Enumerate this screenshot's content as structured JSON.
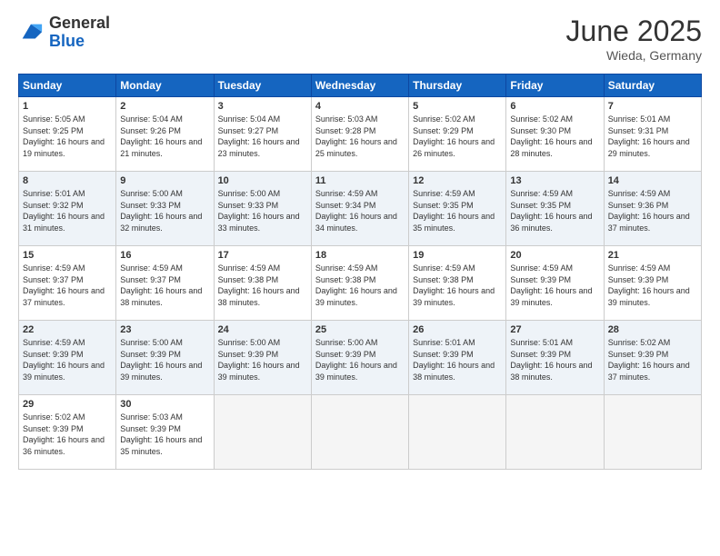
{
  "logo": {
    "general": "General",
    "blue": "Blue"
  },
  "title": {
    "month": "June 2025",
    "location": "Wieda, Germany"
  },
  "days_header": [
    "Sunday",
    "Monday",
    "Tuesday",
    "Wednesday",
    "Thursday",
    "Friday",
    "Saturday"
  ],
  "weeks": [
    [
      {
        "day": "1",
        "sunrise": "Sunrise: 5:05 AM",
        "sunset": "Sunset: 9:25 PM",
        "daylight": "Daylight: 16 hours and 19 minutes."
      },
      {
        "day": "2",
        "sunrise": "Sunrise: 5:04 AM",
        "sunset": "Sunset: 9:26 PM",
        "daylight": "Daylight: 16 hours and 21 minutes."
      },
      {
        "day": "3",
        "sunrise": "Sunrise: 5:04 AM",
        "sunset": "Sunset: 9:27 PM",
        "daylight": "Daylight: 16 hours and 23 minutes."
      },
      {
        "day": "4",
        "sunrise": "Sunrise: 5:03 AM",
        "sunset": "Sunset: 9:28 PM",
        "daylight": "Daylight: 16 hours and 25 minutes."
      },
      {
        "day": "5",
        "sunrise": "Sunrise: 5:02 AM",
        "sunset": "Sunset: 9:29 PM",
        "daylight": "Daylight: 16 hours and 26 minutes."
      },
      {
        "day": "6",
        "sunrise": "Sunrise: 5:02 AM",
        "sunset": "Sunset: 9:30 PM",
        "daylight": "Daylight: 16 hours and 28 minutes."
      },
      {
        "day": "7",
        "sunrise": "Sunrise: 5:01 AM",
        "sunset": "Sunset: 9:31 PM",
        "daylight": "Daylight: 16 hours and 29 minutes."
      }
    ],
    [
      {
        "day": "8",
        "sunrise": "Sunrise: 5:01 AM",
        "sunset": "Sunset: 9:32 PM",
        "daylight": "Daylight: 16 hours and 31 minutes."
      },
      {
        "day": "9",
        "sunrise": "Sunrise: 5:00 AM",
        "sunset": "Sunset: 9:33 PM",
        "daylight": "Daylight: 16 hours and 32 minutes."
      },
      {
        "day": "10",
        "sunrise": "Sunrise: 5:00 AM",
        "sunset": "Sunset: 9:33 PM",
        "daylight": "Daylight: 16 hours and 33 minutes."
      },
      {
        "day": "11",
        "sunrise": "Sunrise: 4:59 AM",
        "sunset": "Sunset: 9:34 PM",
        "daylight": "Daylight: 16 hours and 34 minutes."
      },
      {
        "day": "12",
        "sunrise": "Sunrise: 4:59 AM",
        "sunset": "Sunset: 9:35 PM",
        "daylight": "Daylight: 16 hours and 35 minutes."
      },
      {
        "day": "13",
        "sunrise": "Sunrise: 4:59 AM",
        "sunset": "Sunset: 9:35 PM",
        "daylight": "Daylight: 16 hours and 36 minutes."
      },
      {
        "day": "14",
        "sunrise": "Sunrise: 4:59 AM",
        "sunset": "Sunset: 9:36 PM",
        "daylight": "Daylight: 16 hours and 37 minutes."
      }
    ],
    [
      {
        "day": "15",
        "sunrise": "Sunrise: 4:59 AM",
        "sunset": "Sunset: 9:37 PM",
        "daylight": "Daylight: 16 hours and 37 minutes."
      },
      {
        "day": "16",
        "sunrise": "Sunrise: 4:59 AM",
        "sunset": "Sunset: 9:37 PM",
        "daylight": "Daylight: 16 hours and 38 minutes."
      },
      {
        "day": "17",
        "sunrise": "Sunrise: 4:59 AM",
        "sunset": "Sunset: 9:38 PM",
        "daylight": "Daylight: 16 hours and 38 minutes."
      },
      {
        "day": "18",
        "sunrise": "Sunrise: 4:59 AM",
        "sunset": "Sunset: 9:38 PM",
        "daylight": "Daylight: 16 hours and 39 minutes."
      },
      {
        "day": "19",
        "sunrise": "Sunrise: 4:59 AM",
        "sunset": "Sunset: 9:38 PM",
        "daylight": "Daylight: 16 hours and 39 minutes."
      },
      {
        "day": "20",
        "sunrise": "Sunrise: 4:59 AM",
        "sunset": "Sunset: 9:39 PM",
        "daylight": "Daylight: 16 hours and 39 minutes."
      },
      {
        "day": "21",
        "sunrise": "Sunrise: 4:59 AM",
        "sunset": "Sunset: 9:39 PM",
        "daylight": "Daylight: 16 hours and 39 minutes."
      }
    ],
    [
      {
        "day": "22",
        "sunrise": "Sunrise: 4:59 AM",
        "sunset": "Sunset: 9:39 PM",
        "daylight": "Daylight: 16 hours and 39 minutes."
      },
      {
        "day": "23",
        "sunrise": "Sunrise: 5:00 AM",
        "sunset": "Sunset: 9:39 PM",
        "daylight": "Daylight: 16 hours and 39 minutes."
      },
      {
        "day": "24",
        "sunrise": "Sunrise: 5:00 AM",
        "sunset": "Sunset: 9:39 PM",
        "daylight": "Daylight: 16 hours and 39 minutes."
      },
      {
        "day": "25",
        "sunrise": "Sunrise: 5:00 AM",
        "sunset": "Sunset: 9:39 PM",
        "daylight": "Daylight: 16 hours and 39 minutes."
      },
      {
        "day": "26",
        "sunrise": "Sunrise: 5:01 AM",
        "sunset": "Sunset: 9:39 PM",
        "daylight": "Daylight: 16 hours and 38 minutes."
      },
      {
        "day": "27",
        "sunrise": "Sunrise: 5:01 AM",
        "sunset": "Sunset: 9:39 PM",
        "daylight": "Daylight: 16 hours and 38 minutes."
      },
      {
        "day": "28",
        "sunrise": "Sunrise: 5:02 AM",
        "sunset": "Sunset: 9:39 PM",
        "daylight": "Daylight: 16 hours and 37 minutes."
      }
    ],
    [
      {
        "day": "29",
        "sunrise": "Sunrise: 5:02 AM",
        "sunset": "Sunset: 9:39 PM",
        "daylight": "Daylight: 16 hours and 36 minutes."
      },
      {
        "day": "30",
        "sunrise": "Sunrise: 5:03 AM",
        "sunset": "Sunset: 9:39 PM",
        "daylight": "Daylight: 16 hours and 35 minutes."
      },
      null,
      null,
      null,
      null,
      null
    ]
  ]
}
